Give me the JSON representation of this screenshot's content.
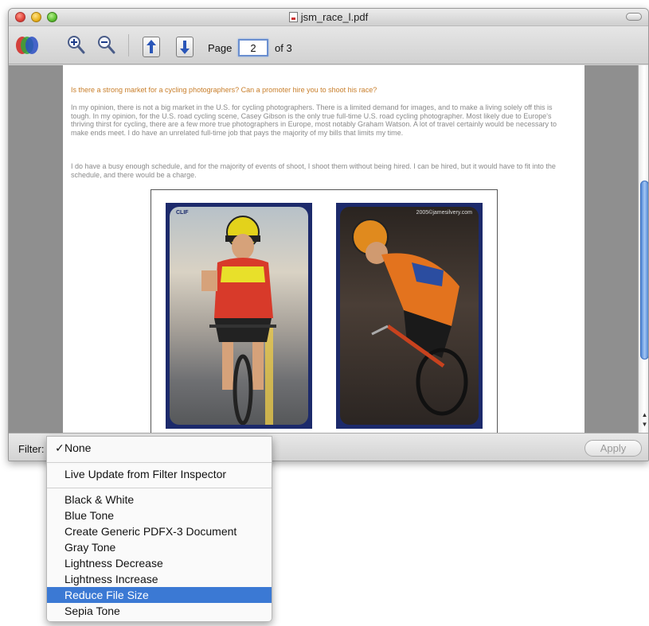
{
  "window": {
    "title": "jsm_race_l.pdf"
  },
  "toolbar": {
    "page_label": "Page",
    "page_value": "2",
    "page_of": "of 3",
    "icons": [
      "color-filter-icon",
      "zoom-in-icon",
      "zoom-out-icon",
      "page-up-icon",
      "page-down-icon"
    ]
  },
  "pdf": {
    "heading": "Is there a strong market for a cycling photographers? Can a promoter hire you to shoot his race?",
    "para1": "In my opinion, there is not a big market in the U.S. for cycling photographers. There is a limited demand for images, and to make a living solely off this is tough. In my opinion, for the U.S. road cycling scene, Casey Gibson is the only true full-time U.S. road cycling photographer. Most likely due to Europe's thriving thirst for cycling, there are a few more true photographers in Europe, most notably Graham Watson. A lot of travel certainly would be necessary to make ends meet. I do have an unrelated full-time job that pays the majority of my bills that limits my time.",
    "para2": "I do have a busy enough schedule, and for the majority of events of shoot, I shoot them without being hired. I can be hired, but it would have to fit into the schedule, and there would be a charge.",
    "photo2_credit": "2005©jamesilvery.com",
    "photo1_credit": "CLIF"
  },
  "bottombar": {
    "filter_label": "Filter:",
    "apply_label": "Apply"
  },
  "menu": {
    "check_mark": "✓",
    "selected": "None",
    "live_update": "Live Update from Filter Inspector",
    "items": [
      "Black & White",
      "Blue Tone",
      "Create Generic PDFX-3 Document",
      "Gray Tone",
      "Lightness Decrease",
      "Lightness Increase",
      "Reduce File Size",
      "Sepia Tone"
    ],
    "highlighted": "Reduce File Size"
  },
  "colors": {
    "highlight": "#3b79d4",
    "scroll_thumb": "#4f86d6",
    "heading_text": "#c87e2a"
  }
}
